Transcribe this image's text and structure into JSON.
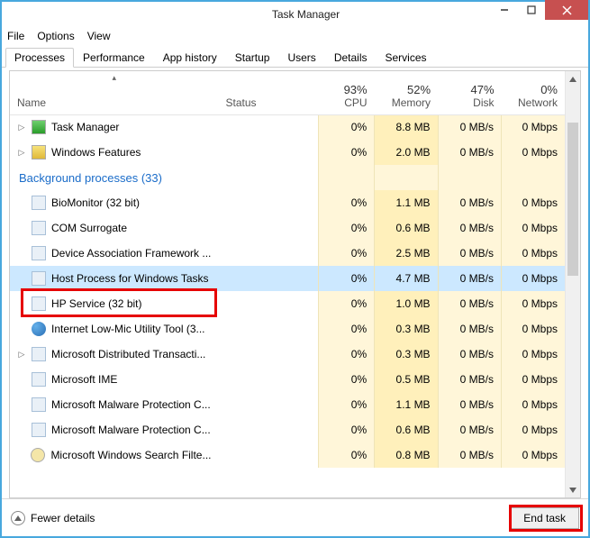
{
  "window": {
    "title": "Task Manager"
  },
  "menu": {
    "file": "File",
    "options": "Options",
    "view": "View"
  },
  "tabs": {
    "processes": "Processes",
    "performance": "Performance",
    "app_history": "App history",
    "startup": "Startup",
    "users": "Users",
    "details": "Details",
    "services": "Services"
  },
  "columns": {
    "name": "Name",
    "status": "Status",
    "cpu_pct": "93%",
    "cpu": "CPU",
    "mem_pct": "52%",
    "mem": "Memory",
    "disk_pct": "47%",
    "disk": "Disk",
    "net_pct": "0%",
    "net": "Network"
  },
  "section": {
    "background": "Background processes (33)"
  },
  "rows": [
    {
      "expandable": true,
      "icon": "tm",
      "name": "Task Manager",
      "cpu": "0%",
      "mem": "8.8 MB",
      "disk": "0 MB/s",
      "net": "0 Mbps"
    },
    {
      "expandable": true,
      "icon": "wf",
      "name": "Windows Features",
      "cpu": "0%",
      "mem": "2.0 MB",
      "disk": "0 MB/s",
      "net": "0 Mbps"
    },
    {
      "section": true
    },
    {
      "expandable": false,
      "icon": "gen",
      "name": "BioMonitor (32 bit)",
      "cpu": "0%",
      "mem": "1.1 MB",
      "disk": "0 MB/s",
      "net": "0 Mbps"
    },
    {
      "expandable": false,
      "icon": "gen",
      "name": "COM Surrogate",
      "cpu": "0%",
      "mem": "0.6 MB",
      "disk": "0 MB/s",
      "net": "0 Mbps"
    },
    {
      "expandable": false,
      "icon": "gen",
      "name": "Device Association Framework ...",
      "cpu": "0%",
      "mem": "2.5 MB",
      "disk": "0 MB/s",
      "net": "0 Mbps"
    },
    {
      "expandable": false,
      "icon": "gen",
      "name": "Host Process for Windows Tasks",
      "cpu": "0%",
      "mem": "4.7 MB",
      "disk": "0 MB/s",
      "net": "0 Mbps",
      "selected": true
    },
    {
      "expandable": false,
      "icon": "gen",
      "name": "HP Service (32 bit)",
      "cpu": "0%",
      "mem": "1.0 MB",
      "disk": "0 MB/s",
      "net": "0 Mbps",
      "highlighted": true
    },
    {
      "expandable": false,
      "icon": "ie",
      "name": "Internet Low-Mic Utility Tool (3...",
      "cpu": "0%",
      "mem": "0.3 MB",
      "disk": "0 MB/s",
      "net": "0 Mbps"
    },
    {
      "expandable": true,
      "icon": "gen",
      "name": "Microsoft Distributed Transacti...",
      "cpu": "0%",
      "mem": "0.3 MB",
      "disk": "0 MB/s",
      "net": "0 Mbps"
    },
    {
      "expandable": false,
      "icon": "gen",
      "name": "Microsoft IME",
      "cpu": "0%",
      "mem": "0.5 MB",
      "disk": "0 MB/s",
      "net": "0 Mbps"
    },
    {
      "expandable": false,
      "icon": "gen",
      "name": "Microsoft Malware Protection C...",
      "cpu": "0%",
      "mem": "1.1 MB",
      "disk": "0 MB/s",
      "net": "0 Mbps"
    },
    {
      "expandable": false,
      "icon": "gen",
      "name": "Microsoft Malware Protection C...",
      "cpu": "0%",
      "mem": "0.6 MB",
      "disk": "0 MB/s",
      "net": "0 Mbps"
    },
    {
      "expandable": false,
      "icon": "srch",
      "name": "Microsoft Windows Search Filte...",
      "cpu": "0%",
      "mem": "0.8 MB",
      "disk": "0 MB/s",
      "net": "0 Mbps"
    }
  ],
  "footer": {
    "fewer": "Fewer details",
    "end_task": "End task"
  }
}
